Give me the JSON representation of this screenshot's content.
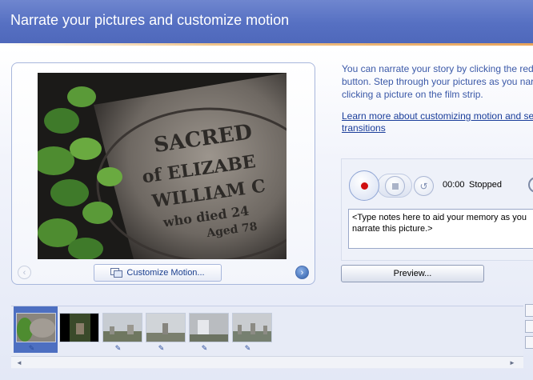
{
  "header": {
    "title": "Narrate your pictures and customize motion"
  },
  "preview": {
    "customize_label": "Customize Motion...",
    "prev_arrow": "‹",
    "next_arrow": "›"
  },
  "info": {
    "description_lines": [
      "You can narrate your story by clicking the red",
      "button. Step through your pictures as you narrate by",
      "clicking a picture on the film strip."
    ],
    "link_lines": [
      "Learn more about customizing motion and setting",
      "transitions"
    ]
  },
  "recorder": {
    "time": "00:00",
    "status": "Stopped",
    "notes_text": "<Type notes here to aid your memory as you narrate this picture.>"
  },
  "actions": {
    "preview_label": "Preview..."
  },
  "filmstrip": {
    "selected_index": 0,
    "thumbs": [
      {
        "name": "thumb-1",
        "edit_icon": true
      },
      {
        "name": "thumb-2",
        "edit_icon": false
      },
      {
        "name": "thumb-3",
        "edit_icon": true
      },
      {
        "name": "thumb-4",
        "edit_icon": true
      },
      {
        "name": "thumb-5",
        "edit_icon": true
      },
      {
        "name": "thumb-6",
        "edit_icon": true
      }
    ]
  },
  "colors": {
    "header_bg": "#5670c2",
    "accent_link": "#1a3d9a",
    "record_red": "#d01010",
    "selected_thumb": "#4d6fc1"
  }
}
